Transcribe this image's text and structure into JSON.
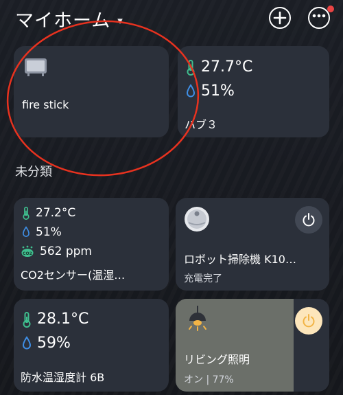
{
  "header": {
    "title": "マイホーム",
    "caret": "▾",
    "add_icon": "plus-icon",
    "more_icon": "ellipsis-icon"
  },
  "section_uncategorized": "未分類",
  "devices": {
    "fire_stick": {
      "name": "fire stick",
      "icon": "tv-box-icon"
    },
    "hub3": {
      "temperature": "27.7°C",
      "humidity": "51%",
      "name": "ハブ３"
    },
    "co2_sensor": {
      "temperature": "27.2°C",
      "humidity": "51%",
      "co2": "562 ppm",
      "name": "CO2センサー(温湿…"
    },
    "robot_vacuum": {
      "name": "ロボット掃除機 K10…",
      "status": "充電完了"
    },
    "waterproof_meter": {
      "temperature": "28.1°C",
      "humidity": "59%",
      "name": "防水温湿度計 6B"
    },
    "living_light": {
      "name": "リビング照明",
      "status": "オン | 77%",
      "level_percent": 77
    }
  },
  "colors": {
    "card": "#2b303a",
    "accent_green": "#3fbf8f",
    "accent_blue": "#3f8fe6",
    "light_on_bg": "#6b6f69",
    "power_on": "#f2b446",
    "annotation_red": "#e8321f"
  }
}
